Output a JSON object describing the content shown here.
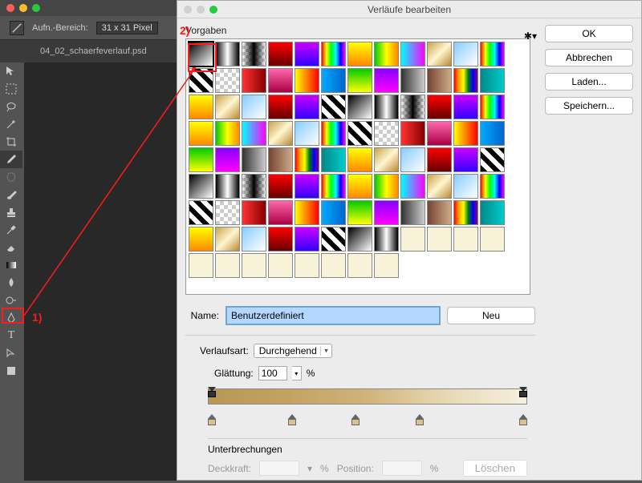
{
  "ps": {
    "options": {
      "aufn_label": "Aufn.-Bereich:",
      "aufn_value": "31 x 31 Pixel"
    },
    "tab": "04_02_schaerfeverlauf.psd"
  },
  "dialog": {
    "title": "Verläufe bearbeiten",
    "presets_label": "Vorgaben",
    "buttons": {
      "ok": "OK",
      "cancel": "Abbrechen",
      "load": "Laden...",
      "save": "Speichern...",
      "new": "Neu"
    },
    "name_label": "Name:",
    "name_value": "Benutzerdefiniert",
    "gradtype_label": "Verlaufsart:",
    "gradtype_value": "Durchgehend",
    "smooth_label": "Glättung:",
    "smooth_value": "100",
    "smooth_unit": "%",
    "breaks_label": "Unterbrechungen",
    "opacity_label": "Deckkraft:",
    "position_label": "Position:",
    "pct": "%",
    "delete": "Löschen"
  },
  "annotations": {
    "one": "1)",
    "two": "2)"
  },
  "chart_data": {
    "type": "table",
    "note": "not a chart image"
  }
}
